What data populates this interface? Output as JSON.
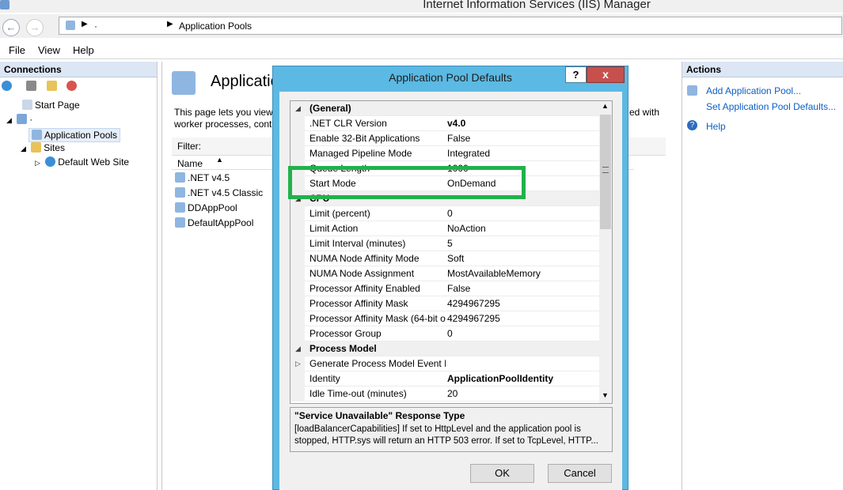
{
  "window": {
    "title": "Internet Information Services (IIS) Manager"
  },
  "address": {
    "seg1": "·",
    "seg2": "Application Pools"
  },
  "menu": {
    "file": "File",
    "view": "View",
    "help": "Help"
  },
  "connections": {
    "title": "Connections",
    "start_page": "Start Page",
    "server": "·",
    "app_pools": "Application Pools",
    "sites": "Sites",
    "default_site": "Default Web Site"
  },
  "center": {
    "title": "Applicatio",
    "desc_line1": "This page lets you view",
    "desc_line2": "worker processes, conta",
    "desc_right": "ed with",
    "filter": "Filter:",
    "col_name": "Name",
    "pools": [
      ".NET v4.5",
      ".NET v4.5 Classic",
      "DDAppPool",
      "DefaultAppPool"
    ]
  },
  "actions": {
    "title": "Actions",
    "add": "Add Application Pool...",
    "set_defaults": "Set Application Pool Defaults...",
    "help": "Help"
  },
  "dialog": {
    "title": "Application Pool Defaults",
    "help_btn": "?",
    "close_btn": "x",
    "rows": [
      {
        "type": "cat",
        "key": "(General)"
      },
      {
        "key": ".NET CLR Version",
        "value": "v4.0",
        "bold": true
      },
      {
        "key": "Enable 32-Bit Applications",
        "value": "False"
      },
      {
        "key": "Managed Pipeline Mode",
        "value": "Integrated"
      },
      {
        "key": "Queue Length",
        "value": "1000"
      },
      {
        "key": "Start Mode",
        "value": "OnDemand"
      },
      {
        "type": "cat",
        "key": "CPU"
      },
      {
        "key": "Limit (percent)",
        "value": "0"
      },
      {
        "key": "Limit Action",
        "value": "NoAction"
      },
      {
        "key": "Limit Interval (minutes)",
        "value": "5"
      },
      {
        "key": "NUMA Node Affinity Mode",
        "value": "Soft"
      },
      {
        "key": "NUMA Node Assignment",
        "value": "MostAvailableMemory"
      },
      {
        "key": "Processor Affinity Enabled",
        "value": "False"
      },
      {
        "key": "Processor Affinity Mask",
        "value": "4294967295"
      },
      {
        "key": "Processor Affinity Mask (64-bit o",
        "value": "4294967295"
      },
      {
        "key": "Processor Group",
        "value": "0"
      },
      {
        "type": "cat",
        "key": "Process Model"
      },
      {
        "key": "Generate Process Model Event L",
        "value": "",
        "expand": true
      },
      {
        "key": "Identity",
        "value": "ApplicationPoolIdentity",
        "bold": true
      },
      {
        "key": "Idle Time-out (minutes)",
        "value": "20"
      }
    ],
    "desc_title": "\"Service Unavailable\" Response Type",
    "desc_line1": "[loadBalancerCapabilities] If set to HttpLevel and the application pool is",
    "desc_line2": "stopped, HTTP.sys will return an HTTP 503 error.  If set to TcpLevel, HTTP...",
    "ok": "OK",
    "cancel": "Cancel"
  },
  "colors": {
    "dialog_frame": "#5cb9e3",
    "highlight": "#22b14c",
    "close": "#c7504d"
  }
}
